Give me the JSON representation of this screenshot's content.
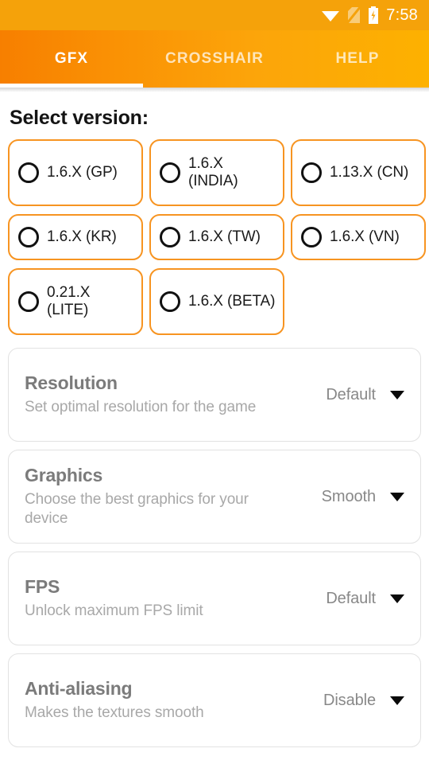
{
  "status_bar": {
    "time": "7:58",
    "icons": [
      "wifi-icon",
      "no-sim-icon",
      "battery-charging-icon"
    ],
    "background_color": "#f5a20a"
  },
  "tab_bar": {
    "accent_color": "#f79421",
    "active_index": 0,
    "tabs": [
      {
        "label": "GFX"
      },
      {
        "label": "CROSSHAIR"
      },
      {
        "label": "HELP"
      }
    ]
  },
  "main": {
    "section_title": "Select version:",
    "versions": [
      {
        "label": "1.6.X (GP)",
        "selected": false,
        "tall": false
      },
      {
        "label": "1.6.X (INDIA)",
        "selected": false,
        "tall": true
      },
      {
        "label": "1.13.X (CN)",
        "selected": false,
        "tall": false
      },
      {
        "label": "1.6.X (KR)",
        "selected": false,
        "tall": false
      },
      {
        "label": "1.6.X (TW)",
        "selected": false,
        "tall": false
      },
      {
        "label": "1.6.X (VN)",
        "selected": false,
        "tall": false
      },
      {
        "label": "0.21.X (LITE)",
        "selected": false,
        "tall": false
      },
      {
        "label": "1.6.X (BETA)",
        "selected": false,
        "tall": true
      }
    ],
    "settings": [
      {
        "title": "Resolution",
        "description": "Set optimal resolution for the game",
        "value": "Default"
      },
      {
        "title": "Graphics",
        "description": "Choose the best graphics for your device",
        "value": "Smooth"
      },
      {
        "title": "FPS",
        "description": "Unlock maximum FPS limit",
        "value": "Default"
      },
      {
        "title": "Anti-aliasing",
        "description": "Makes the textures smooth",
        "value": "Disable"
      }
    ]
  }
}
